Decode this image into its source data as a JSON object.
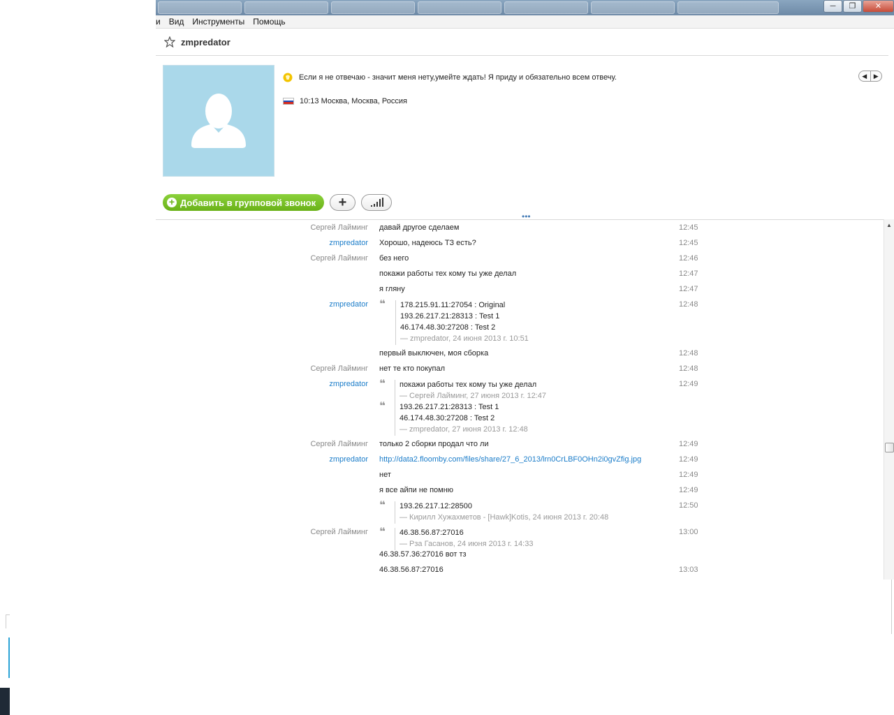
{
  "menu": [
    "и",
    "Вид",
    "Инструменты",
    "Помощь"
  ],
  "contact": {
    "name": "zmpredator",
    "mood": "Если я не отвечаю - значит меня нету,умейте ждать! Я приду и обязательно всем отвечу.",
    "location": "10:13 Москва, Москва, Россия"
  },
  "buttons": {
    "group_call": "Добавить в групповой звонок"
  },
  "messages": [
    {
      "sender": "Сергей Лайминг",
      "text": "давай другое сделаем",
      "time": "12:45"
    },
    {
      "sender": "zmpredator",
      "text": "Хорошо, надеюсь ТЗ есть?",
      "time": "12:45"
    },
    {
      "sender": "Сергей Лайминг",
      "text": "без него",
      "time": "12:46"
    },
    {
      "sender": "",
      "text": "покажи работы тех кому ты уже делал",
      "time": "12:47"
    },
    {
      "sender": "",
      "text": "я гляну",
      "time": "12:47"
    },
    {
      "sender": "zmpredator",
      "time": "12:48",
      "quote": {
        "lines": [
          "178.215.91.11:27054 : Original",
          "193.26.217.21:28313 : Test 1",
          "46.174.48.30:27208 : Test 2"
        ],
        "attr": "— zmpredator, 24 июня 2013 г. 10:51"
      }
    },
    {
      "sender": "",
      "text": "первый выключен, моя сборка",
      "time": "12:48"
    },
    {
      "sender": "Сергей Лайминг",
      "text": "нет те кто покупал",
      "time": "12:48"
    },
    {
      "sender": "zmpredator",
      "time": "12:49",
      "quote": {
        "lines": [
          "покажи работы тех кому ты уже делал"
        ],
        "attr": "— Сергей Лайминг, 27 июня 2013 г. 12:47"
      },
      "quote2": {
        "lines": [
          "193.26.217.21:28313 : Test 1",
          "46.174.48.30:27208 : Test 2"
        ],
        "attr": "— zmpredator, 27 июня 2013 г. 12:48"
      }
    },
    {
      "sender": "Сергей Лайминг",
      "text": "только 2 сборки продал что ли",
      "time": "12:49"
    },
    {
      "sender": "zmpredator",
      "link": "http://data2.floomby.com/files/share/27_6_2013/lrn0CrLBF0OHn2i0gvZfig.jpg",
      "time": "12:49"
    },
    {
      "sender": "",
      "text": "нет",
      "time": "12:49"
    },
    {
      "sender": "",
      "text": "я все айпи не помню",
      "time": "12:49"
    },
    {
      "sender": "",
      "time": "12:50",
      "quote": {
        "lines": [
          "193.26.217.12:28500"
        ],
        "attr": "— Кирилл Хужахметов - [Hawk]Kotis, 24 июня 2013 г. 20:48"
      }
    },
    {
      "sender": "Сергей Лайминг",
      "time": "13:00",
      "quote": {
        "lines": [
          "46.38.56.87:27016"
        ],
        "attr": "— Рза Гасанов, 24 июня 2013 г. 14:33"
      },
      "after": "46.38.57.36:27016  вот тз"
    },
    {
      "sender": "",
      "text": "46.38.56.87:27016",
      "time": "13:03"
    }
  ]
}
